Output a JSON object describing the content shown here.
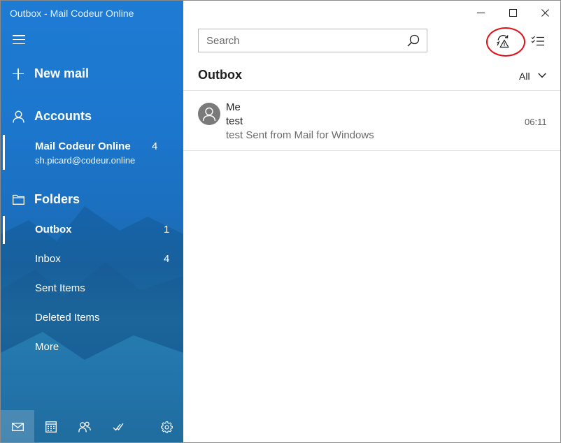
{
  "window": {
    "title": "Outbox - Mail Codeur Online"
  },
  "sidebar": {
    "new_mail": "New mail",
    "accounts_heading": "Accounts",
    "account": {
      "name": "Mail Codeur Online",
      "email": "sh.picard@codeur.online",
      "count": "4"
    },
    "folders_heading": "Folders",
    "folders": [
      {
        "name": "Outbox",
        "count": "1"
      },
      {
        "name": "Inbox",
        "count": "4"
      },
      {
        "name": "Sent Items",
        "count": ""
      },
      {
        "name": "Deleted Items",
        "count": ""
      },
      {
        "name": "More",
        "count": ""
      }
    ]
  },
  "main": {
    "search_placeholder": "Search",
    "list_title": "Outbox",
    "filter_label": "All",
    "messages": [
      {
        "sender": "Me",
        "subject": "test",
        "preview": "test Sent from Mail for Windows",
        "time": "06:11"
      }
    ]
  },
  "icons": {
    "hamburger": "hamburger-menu-icon",
    "new_mail": "plus-icon",
    "accounts": "person-icon",
    "folders": "folder-icon",
    "search": "search-icon",
    "sync": "sync-warning-icon",
    "select": "checklist-icon",
    "filter": "chevron-down-icon",
    "minimize": "minimize-icon",
    "maximize": "maximize-icon",
    "close": "close-icon",
    "mail": "mail-icon",
    "calendar": "calendar-icon",
    "people": "people-icon",
    "todo": "todo-check-icon",
    "settings": "gear-icon"
  },
  "colors": {
    "sidebar_blue": "#1e7bd3",
    "highlight_red": "#e0101a"
  }
}
